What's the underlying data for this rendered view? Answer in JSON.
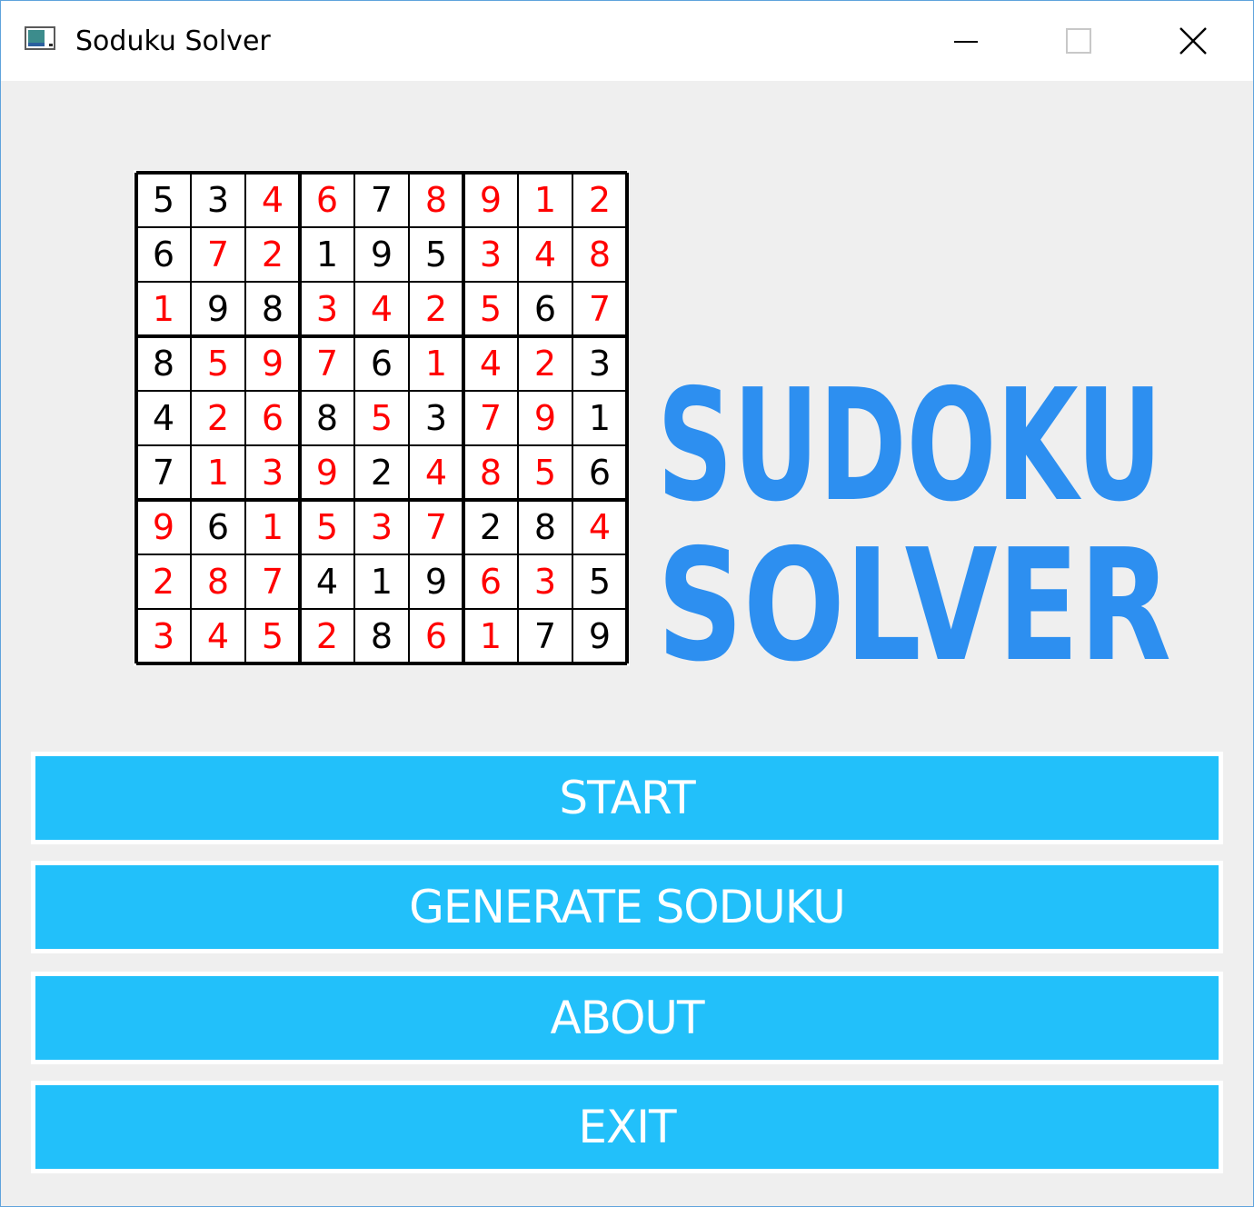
{
  "window": {
    "title": "Soduku Solver",
    "minimize_glyph": "—",
    "maximize_glyph": "☐",
    "close_glyph": "✕"
  },
  "logo": {
    "line1": "SUDOKU",
    "line2": "SOLVER",
    "color": "#2d8ff0"
  },
  "sudoku_image": {
    "given_color": "#000000",
    "solved_color": "#ff0000",
    "cells": [
      [
        [
          5,
          0
        ],
        [
          3,
          0
        ],
        [
          4,
          1
        ],
        [
          6,
          1
        ],
        [
          7,
          0
        ],
        [
          8,
          1
        ],
        [
          9,
          1
        ],
        [
          1,
          1
        ],
        [
          2,
          1
        ]
      ],
      [
        [
          6,
          0
        ],
        [
          7,
          1
        ],
        [
          2,
          1
        ],
        [
          1,
          0
        ],
        [
          9,
          0
        ],
        [
          5,
          0
        ],
        [
          3,
          1
        ],
        [
          4,
          1
        ],
        [
          8,
          1
        ]
      ],
      [
        [
          1,
          1
        ],
        [
          9,
          0
        ],
        [
          8,
          0
        ],
        [
          3,
          1
        ],
        [
          4,
          1
        ],
        [
          2,
          1
        ],
        [
          5,
          1
        ],
        [
          6,
          0
        ],
        [
          7,
          1
        ]
      ],
      [
        [
          8,
          0
        ],
        [
          5,
          1
        ],
        [
          9,
          1
        ],
        [
          7,
          1
        ],
        [
          6,
          0
        ],
        [
          1,
          1
        ],
        [
          4,
          1
        ],
        [
          2,
          1
        ],
        [
          3,
          0
        ]
      ],
      [
        [
          4,
          0
        ],
        [
          2,
          1
        ],
        [
          6,
          1
        ],
        [
          8,
          0
        ],
        [
          5,
          1
        ],
        [
          3,
          0
        ],
        [
          7,
          1
        ],
        [
          9,
          1
        ],
        [
          1,
          0
        ]
      ],
      [
        [
          7,
          0
        ],
        [
          1,
          1
        ],
        [
          3,
          1
        ],
        [
          9,
          1
        ],
        [
          2,
          0
        ],
        [
          4,
          1
        ],
        [
          8,
          1
        ],
        [
          5,
          1
        ],
        [
          6,
          0
        ]
      ],
      [
        [
          9,
          1
        ],
        [
          6,
          0
        ],
        [
          1,
          1
        ],
        [
          5,
          1
        ],
        [
          3,
          1
        ],
        [
          7,
          1
        ],
        [
          2,
          0
        ],
        [
          8,
          0
        ],
        [
          4,
          1
        ]
      ],
      [
        [
          2,
          1
        ],
        [
          8,
          1
        ],
        [
          7,
          1
        ],
        [
          4,
          0
        ],
        [
          1,
          0
        ],
        [
          9,
          0
        ],
        [
          6,
          1
        ],
        [
          3,
          1
        ],
        [
          5,
          0
        ]
      ],
      [
        [
          3,
          1
        ],
        [
          4,
          1
        ],
        [
          5,
          1
        ],
        [
          2,
          1
        ],
        [
          8,
          0
        ],
        [
          6,
          1
        ],
        [
          1,
          1
        ],
        [
          7,
          0
        ],
        [
          9,
          0
        ]
      ]
    ]
  },
  "menu": {
    "button_color": "#22c0fa",
    "start_label": "START",
    "generate_label": "GENERATE SODUKU",
    "about_label": "ABOUT",
    "exit_label": "EXIT"
  }
}
